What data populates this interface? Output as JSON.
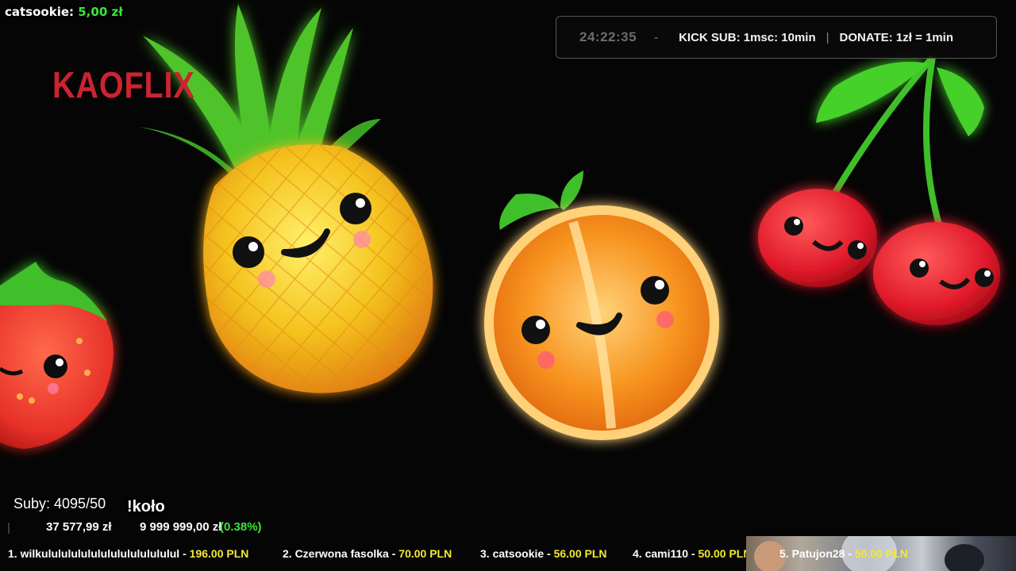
{
  "alert": {
    "user": "catsookie:",
    "amount": "5,00 zł"
  },
  "brand": {
    "logo_text": "KAOFLIX"
  },
  "info_bar": {
    "timer": "24:22:35",
    "dash": "-",
    "kick_sub": "KICK SUB: 1msc: 10min",
    "divider": "|",
    "donate": "DONATE: 1zł = 1min"
  },
  "subs": {
    "label": "Suby: 4095/50"
  },
  "wheel": {
    "command": "!koło"
  },
  "goal": {
    "current": "37 577,99 zł",
    "target": "9 999 999,00 zł",
    "percent_text": "(0.38%)",
    "progress": 0.0038
  },
  "leaderboard": [
    {
      "name": "1. wilkulululululululululululululul - ",
      "value": "196.00 PLN"
    },
    {
      "name": "2. Czerwona fasolka - ",
      "value": "70.00 PLN"
    },
    {
      "name": "3. catsookie - ",
      "value": "56.00 PLN"
    },
    {
      "name": "4. cami110 - ",
      "value": "50.00 PLN"
    },
    {
      "name": "5. Patujon28 - ",
      "value": "50.00 PLN"
    }
  ],
  "colors": {
    "alert_amount": "#39e639",
    "logo": "#cc2331",
    "leader_value": "#f5e832",
    "pineapple": "#f4c21d",
    "orange": "#f7931e",
    "cherry": "#e0192a",
    "strawberry": "#e8312a",
    "leaf": "#3fbf2a"
  },
  "scene": {
    "fruits": [
      "strawberry",
      "pineapple",
      "orange",
      "cherries"
    ]
  }
}
